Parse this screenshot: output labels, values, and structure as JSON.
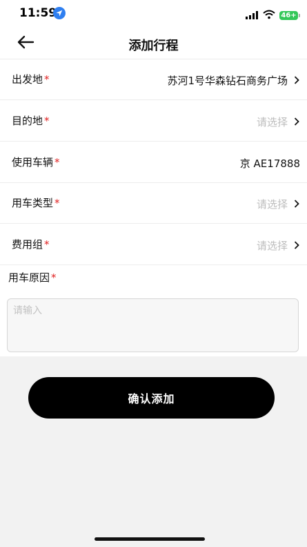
{
  "status": {
    "time": "11:59",
    "battery": "46+",
    "icons": [
      "location-arrow-icon",
      "signal-icon",
      "wifi-icon",
      "battery-icon"
    ]
  },
  "nav": {
    "title": "添加行程",
    "back_icon": "arrow-left-icon"
  },
  "form": {
    "required_mark": "*",
    "rows": [
      {
        "label": "出发地",
        "value": "苏河1号华森钻石商务广场",
        "placeholder": false,
        "arrow": true
      },
      {
        "label": "目的地",
        "value": "请选择",
        "placeholder": true,
        "arrow": true
      },
      {
        "label": "使用车辆",
        "value": "京 AE17888",
        "placeholder": false,
        "arrow": false
      },
      {
        "label": "用车类型",
        "value": "请选择",
        "placeholder": true,
        "arrow": true
      },
      {
        "label": "费用组",
        "value": "请选择",
        "placeholder": true,
        "arrow": true
      }
    ],
    "reason": {
      "label": "用车原因",
      "placeholder": "请输入",
      "value": ""
    }
  },
  "actions": {
    "confirm_label": "确认添加"
  },
  "colors": {
    "required": "#e02020",
    "placeholder": "#bdbdbd",
    "button_bg": "#000000",
    "page_bg": "#f2f2f2",
    "battery": "#34c759",
    "location_badge": "#2f7ff0"
  }
}
